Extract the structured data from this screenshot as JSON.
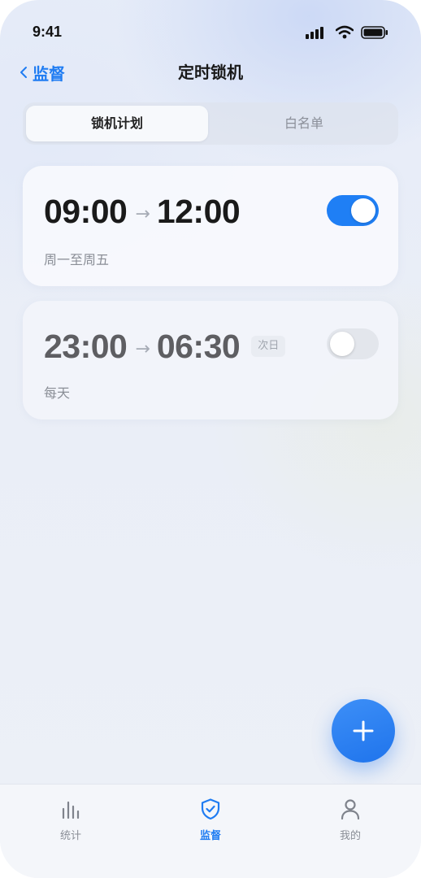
{
  "status_bar": {
    "time": "9:41",
    "icons": [
      "signal-icon",
      "wifi-icon",
      "battery-icon"
    ]
  },
  "nav": {
    "back_icon": "chevron-left-icon",
    "back_label": "监督",
    "title": "定时锁机"
  },
  "segmented": {
    "tabs": [
      {
        "label": "锁机计划",
        "active": true
      },
      {
        "label": "白名单",
        "active": false
      }
    ]
  },
  "schedules": [
    {
      "start": "09:00",
      "end": "12:00",
      "next_day_badge": "",
      "repeat": "周一至周五",
      "enabled": true
    },
    {
      "start": "23:00",
      "end": "06:30",
      "next_day_badge": "次日",
      "repeat": "每天",
      "enabled": false
    }
  ],
  "arrow_glyph": "→",
  "fab": {
    "icon": "plus-icon"
  },
  "tabbar": {
    "items": [
      {
        "label": "统计",
        "icon": "bar-chart-icon",
        "active": false
      },
      {
        "label": "监督",
        "icon": "shield-check-icon",
        "active": true
      },
      {
        "label": "我的",
        "icon": "user-icon",
        "active": false
      }
    ]
  },
  "colors": {
    "accent": "#1f7ff5",
    "toggle_off": "#e3e6ec",
    "text_primary": "#1a1a1a",
    "text_secondary": "#8a8e96"
  }
}
